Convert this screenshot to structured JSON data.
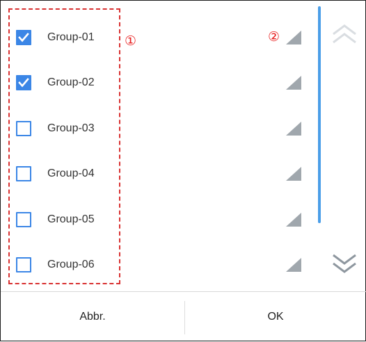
{
  "groups": [
    {
      "label": "Group-01",
      "checked": true
    },
    {
      "label": "Group-02",
      "checked": true
    },
    {
      "label": "Group-03",
      "checked": false
    },
    {
      "label": "Group-04",
      "checked": false
    },
    {
      "label": "Group-05",
      "checked": false
    },
    {
      "label": "Group-06",
      "checked": false
    }
  ],
  "annotations": {
    "marker_1": "①",
    "marker_2": "②"
  },
  "icons": {
    "checkbox": "checkbox-icon",
    "row_indicator": "triangle-corner-icon",
    "scroll_up": "chevron-double-up-icon",
    "scroll_down": "chevron-double-down-icon"
  },
  "colors": {
    "accent": "#3b86e6",
    "scrollbar": "#4a9ee8",
    "annotation": "#e81c1c",
    "indicator": "#a0a7ad"
  },
  "footer": {
    "abbr_label": "Abbr.",
    "ok_label": "OK"
  }
}
